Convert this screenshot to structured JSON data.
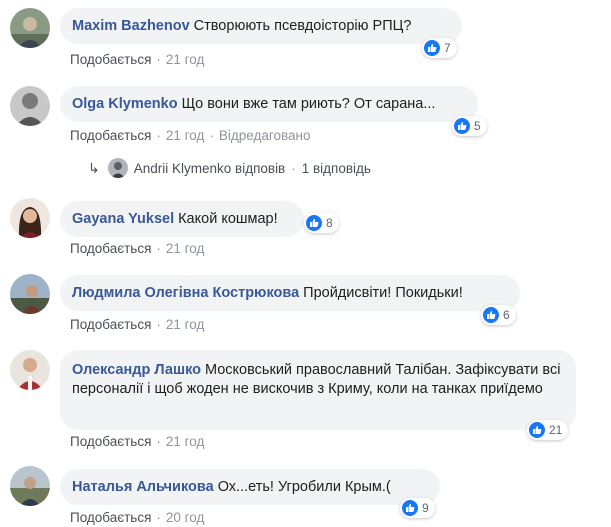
{
  "comments": [
    {
      "author": "Maxim Bazhenov",
      "text": "Створюють псевдоісторію РПЦ?",
      "likes": "7",
      "like_label": "Подобається",
      "time": "21 год",
      "avatar_icon": "person-avatar"
    },
    {
      "author": "Olga Klymenko",
      "text": "Що вони вже там риють? От сарана...",
      "likes": "5",
      "like_label": "Подобається",
      "time": "21 год",
      "edited": "Відредаговано",
      "avatar_icon": "person-avatar"
    },
    {
      "author": "Gayana Yuksel",
      "text": "Какой кошмар!",
      "likes": "8",
      "like_label": "Подобається",
      "time": "21 год",
      "avatar_icon": "person-avatar"
    },
    {
      "author": "Людмила Олегівна Кострюкова",
      "text": "Пройдисвіти! Покидьки!",
      "likes": "6",
      "like_label": "Подобається",
      "time": "21 год",
      "avatar_icon": "person-avatar"
    },
    {
      "author": "Олександр Лашко",
      "text": "Московський православний Талібан. Зафіксувати всі персоналії і щоб жоден не вискочив з Криму, коли на танках приїдемо",
      "likes": "21",
      "like_label": "Подобається",
      "time": "21 год",
      "avatar_icon": "person-avatar"
    },
    {
      "author": "Наталья Альчикова",
      "text": "Ох...еть! Угробили Крым.(",
      "likes": "9",
      "like_label": "Подобається",
      "time": "20 год",
      "avatar_icon": "person-avatar"
    }
  ],
  "reply": {
    "text": "Andrii Klymenko відповів",
    "count": "1 відповідь",
    "arrow_icon": "reply-arrow-icon"
  },
  "colors": {
    "author": "#385898",
    "bubble": "#f2f3f5",
    "like": "#1877f2",
    "meta": "#90949c"
  }
}
